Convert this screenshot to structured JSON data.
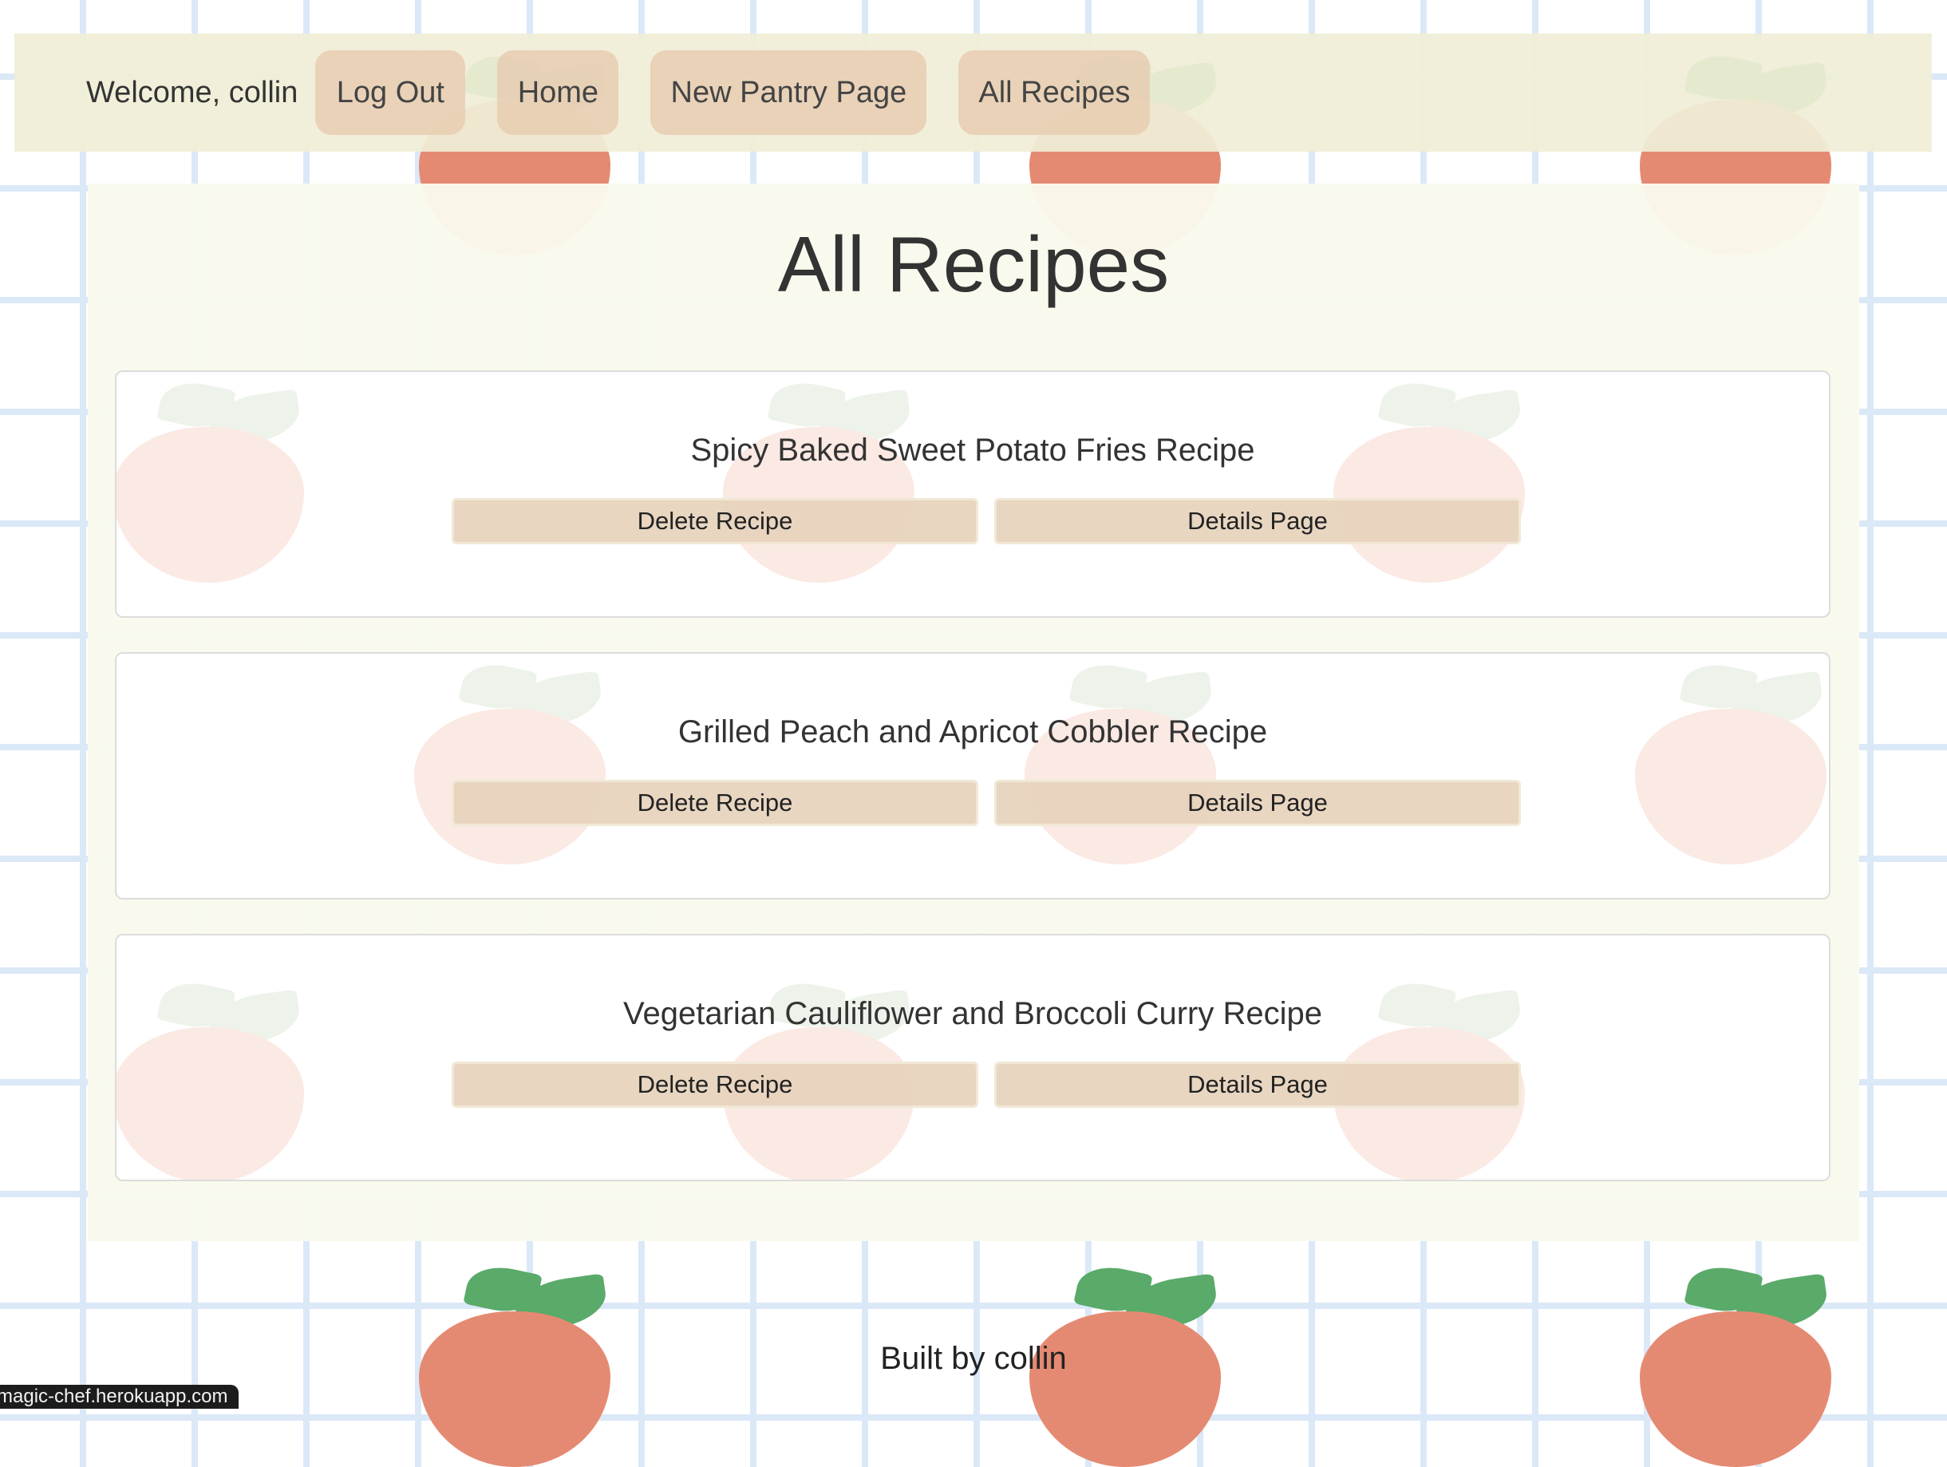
{
  "header": {
    "welcome_text": "Welcome, collin",
    "nav": {
      "logout": "Log Out",
      "home": "Home",
      "new_pantry": "New Pantry Page",
      "all_recipes": "All Recipes"
    }
  },
  "main": {
    "title": "All Recipes",
    "recipes": [
      {
        "name": "Spicy Baked Sweet Potato Fries Recipe",
        "delete_label": "Delete Recipe",
        "details_label": "Details Page"
      },
      {
        "name": "Grilled Peach and Apricot Cobbler Recipe",
        "delete_label": "Delete Recipe",
        "details_label": "Details Page"
      },
      {
        "name": "Vegetarian Cauliflower and Broccoli Curry Recipe",
        "delete_label": "Delete Recipe",
        "details_label": "Details Page"
      }
    ]
  },
  "footer": {
    "text": "Built by collin"
  },
  "status_bar": {
    "link_preview": "magic-chef.herokuapp.com"
  },
  "colors": {
    "grid_line": "#dbe8f7",
    "navbar_bg": "#f0eed6",
    "button_bg": "#e7ccb2",
    "panel_bg": "#f9faec",
    "peach": "#e58a72",
    "leaf": "#5aaa6a"
  }
}
